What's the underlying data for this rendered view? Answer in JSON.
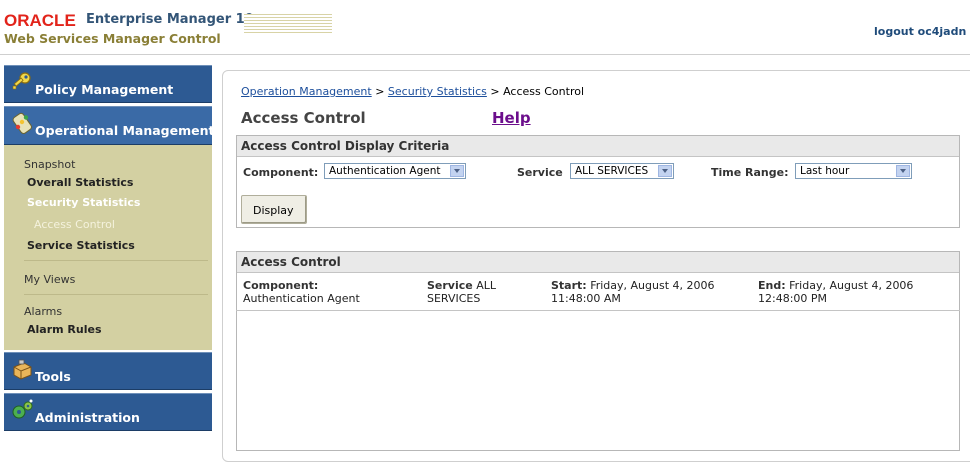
{
  "header": {
    "oracle_logo": "ORACLE",
    "product_name": "Enterprise Manager 10g",
    "subtitle": "Web Services Manager Control",
    "logout_label": "logout oc4jadn"
  },
  "sidebar": {
    "tabs": [
      {
        "label": "Policy Management",
        "icon": "key-icon"
      },
      {
        "label": "Operational Management",
        "icon": "traffic-light-icon"
      },
      {
        "label": "Tools",
        "icon": "toolbox-icon"
      },
      {
        "label": "Administration",
        "icon": "gears-icon"
      }
    ],
    "panel": {
      "snapshot_section": "Snapshot",
      "overall_statistics": "Overall Statistics",
      "security_statistics": "Security Statistics",
      "access_control": "Access Control",
      "service_statistics": "Service Statistics",
      "my_views": "My Views",
      "alarms_section": "Alarms",
      "alarm_rules": "Alarm Rules"
    }
  },
  "breadcrumb": {
    "items": [
      "Operation Management",
      "Security Statistics",
      "Access Control"
    ],
    "separator": ">"
  },
  "page": {
    "title": "Access Control",
    "help_label": "Help"
  },
  "criteria": {
    "header": "Access Control Display Criteria",
    "component_label": "Component:",
    "component_value": "Authentication Agent",
    "service_label": "Service",
    "service_value": "ALL SERVICES",
    "time_range_label": "Time Range:",
    "time_range_value": "Last hour",
    "display_button": "Display"
  },
  "results": {
    "header": "Access Control",
    "component_label": "Component:",
    "component_value": "Authentication Agent",
    "service_label": "Service",
    "service_value_line1": "ALL",
    "service_value_line2": "SERVICES",
    "start_label": "Start:",
    "start_line1": "Friday, August 4, 2006",
    "start_line2": "11:48:00 AM",
    "end_label": "End:",
    "end_line1": "Friday, August 4, 2006",
    "end_line2": "12:48:00 PM"
  },
  "colors": {
    "nav_blue": "#2d5a93",
    "nav_panel": "#d3d0a2",
    "oracle_red": "#e2231a",
    "link_blue": "#1d4f9c",
    "help_purple": "#6c0e8c"
  }
}
